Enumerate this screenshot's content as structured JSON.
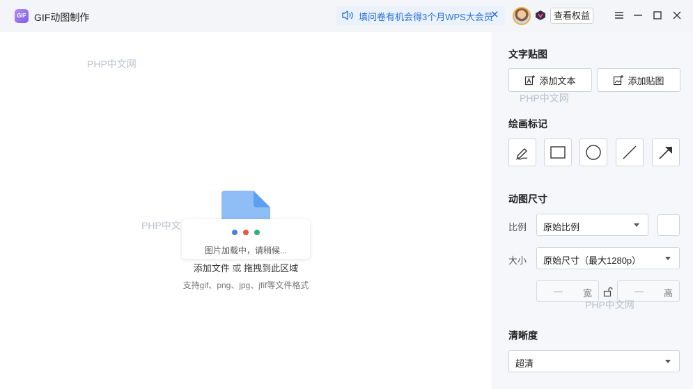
{
  "app": {
    "logo_text": "GIF",
    "title": "GIF动图制作"
  },
  "notice": {
    "icon": "speaker-icon",
    "text": "填问卷有机会得3个月WPS大会员",
    "close": "✕"
  },
  "header": {
    "rights_button": "查看权益",
    "menu_icon": "hamburger-menu-icon",
    "window_controls": [
      "minimize-icon",
      "maximize-icon",
      "close-icon"
    ]
  },
  "canvas": {
    "watermark": "PHP中文网",
    "loading_text": "图片加载中，请稍候...",
    "add_file": "添加文件",
    "or": "或",
    "drag_here": "拖拽到此区域",
    "format_hint": "支持gif、png、jpg、jfif等文件格式",
    "dot_colors": [
      "#4a7fe0",
      "#e6553f",
      "#2fb27a"
    ]
  },
  "panel": {
    "text_sticker": {
      "title": "文字贴图",
      "add_text": "添加文本",
      "add_sticker": "添加贴图"
    },
    "drawing": {
      "title": "绘画标记",
      "tools": [
        "pen-icon",
        "rectangle-icon",
        "circle-icon",
        "line-icon",
        "arrow-icon"
      ]
    },
    "size": {
      "title": "动图尺寸",
      "ratio_label": "比例",
      "ratio_value": "原始比例",
      "size_label": "大小",
      "size_value": "原始尺寸（最大1280p）",
      "width_placeholder": "—",
      "width_unit": "宽",
      "height_placeholder": "—",
      "height_unit": "高"
    },
    "quality": {
      "title": "清晰度",
      "value": "超清"
    },
    "watermark": "PHP中文网"
  },
  "colors": {
    "accent": "#2a6fd6",
    "file_icon": "#8fbdf6"
  }
}
